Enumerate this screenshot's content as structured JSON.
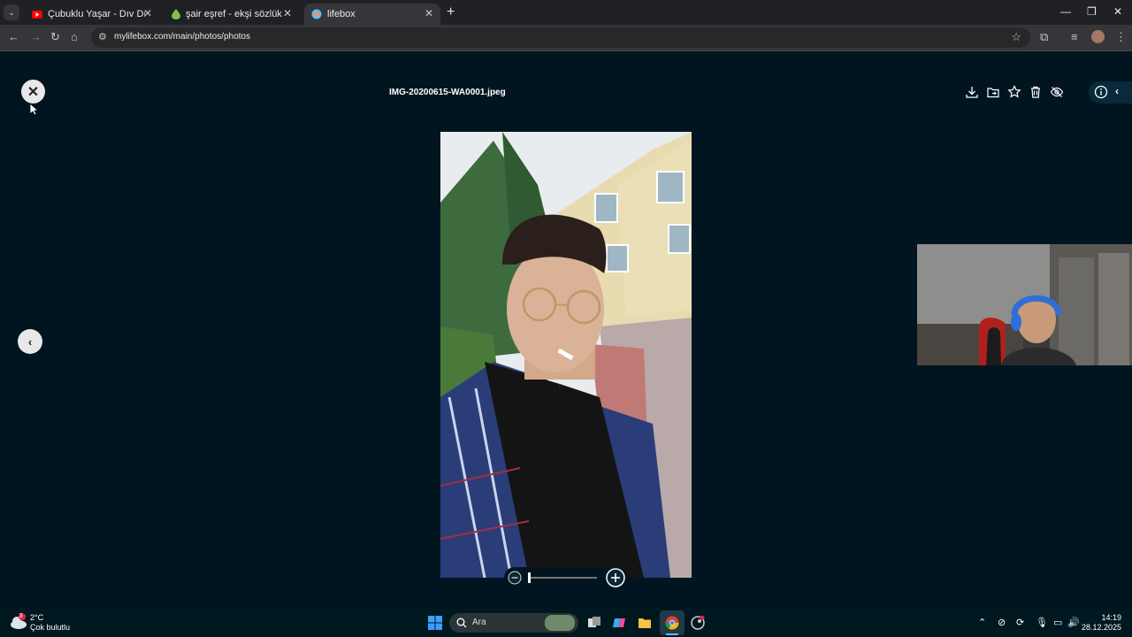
{
  "browser": {
    "tabs": [
      {
        "title": "Çubuklu Yaşar - Dıv Dıv (Of",
        "favicon": "youtube-icon",
        "color": "#ff0000"
      },
      {
        "title": "şair eşref - ekşi sözlük",
        "favicon": "drop-icon",
        "color": "#81c14b"
      },
      {
        "title": "lifebox",
        "favicon": "lifebox-icon",
        "color": "#4fc3f7"
      }
    ],
    "url": "mylifebox.com/main/photos/photos"
  },
  "viewer": {
    "filename": "IMG-20200615-WA0001.jpeg",
    "actions": [
      "download-icon",
      "move-folder-icon",
      "favorite-star-icon",
      "delete-trash-icon",
      "hide-eye-icon",
      "info-icon",
      "chevron-left-icon"
    ],
    "zoom_level": 0
  },
  "taskbar": {
    "weather_temp": "2°C",
    "weather_desc": "Çok bulutlu",
    "weather_badge": "3",
    "search_placeholder": "Ara",
    "time": "14:19",
    "date": "28.12.2025"
  },
  "colors": {
    "background": "#001520",
    "accent": "#0078d4"
  }
}
